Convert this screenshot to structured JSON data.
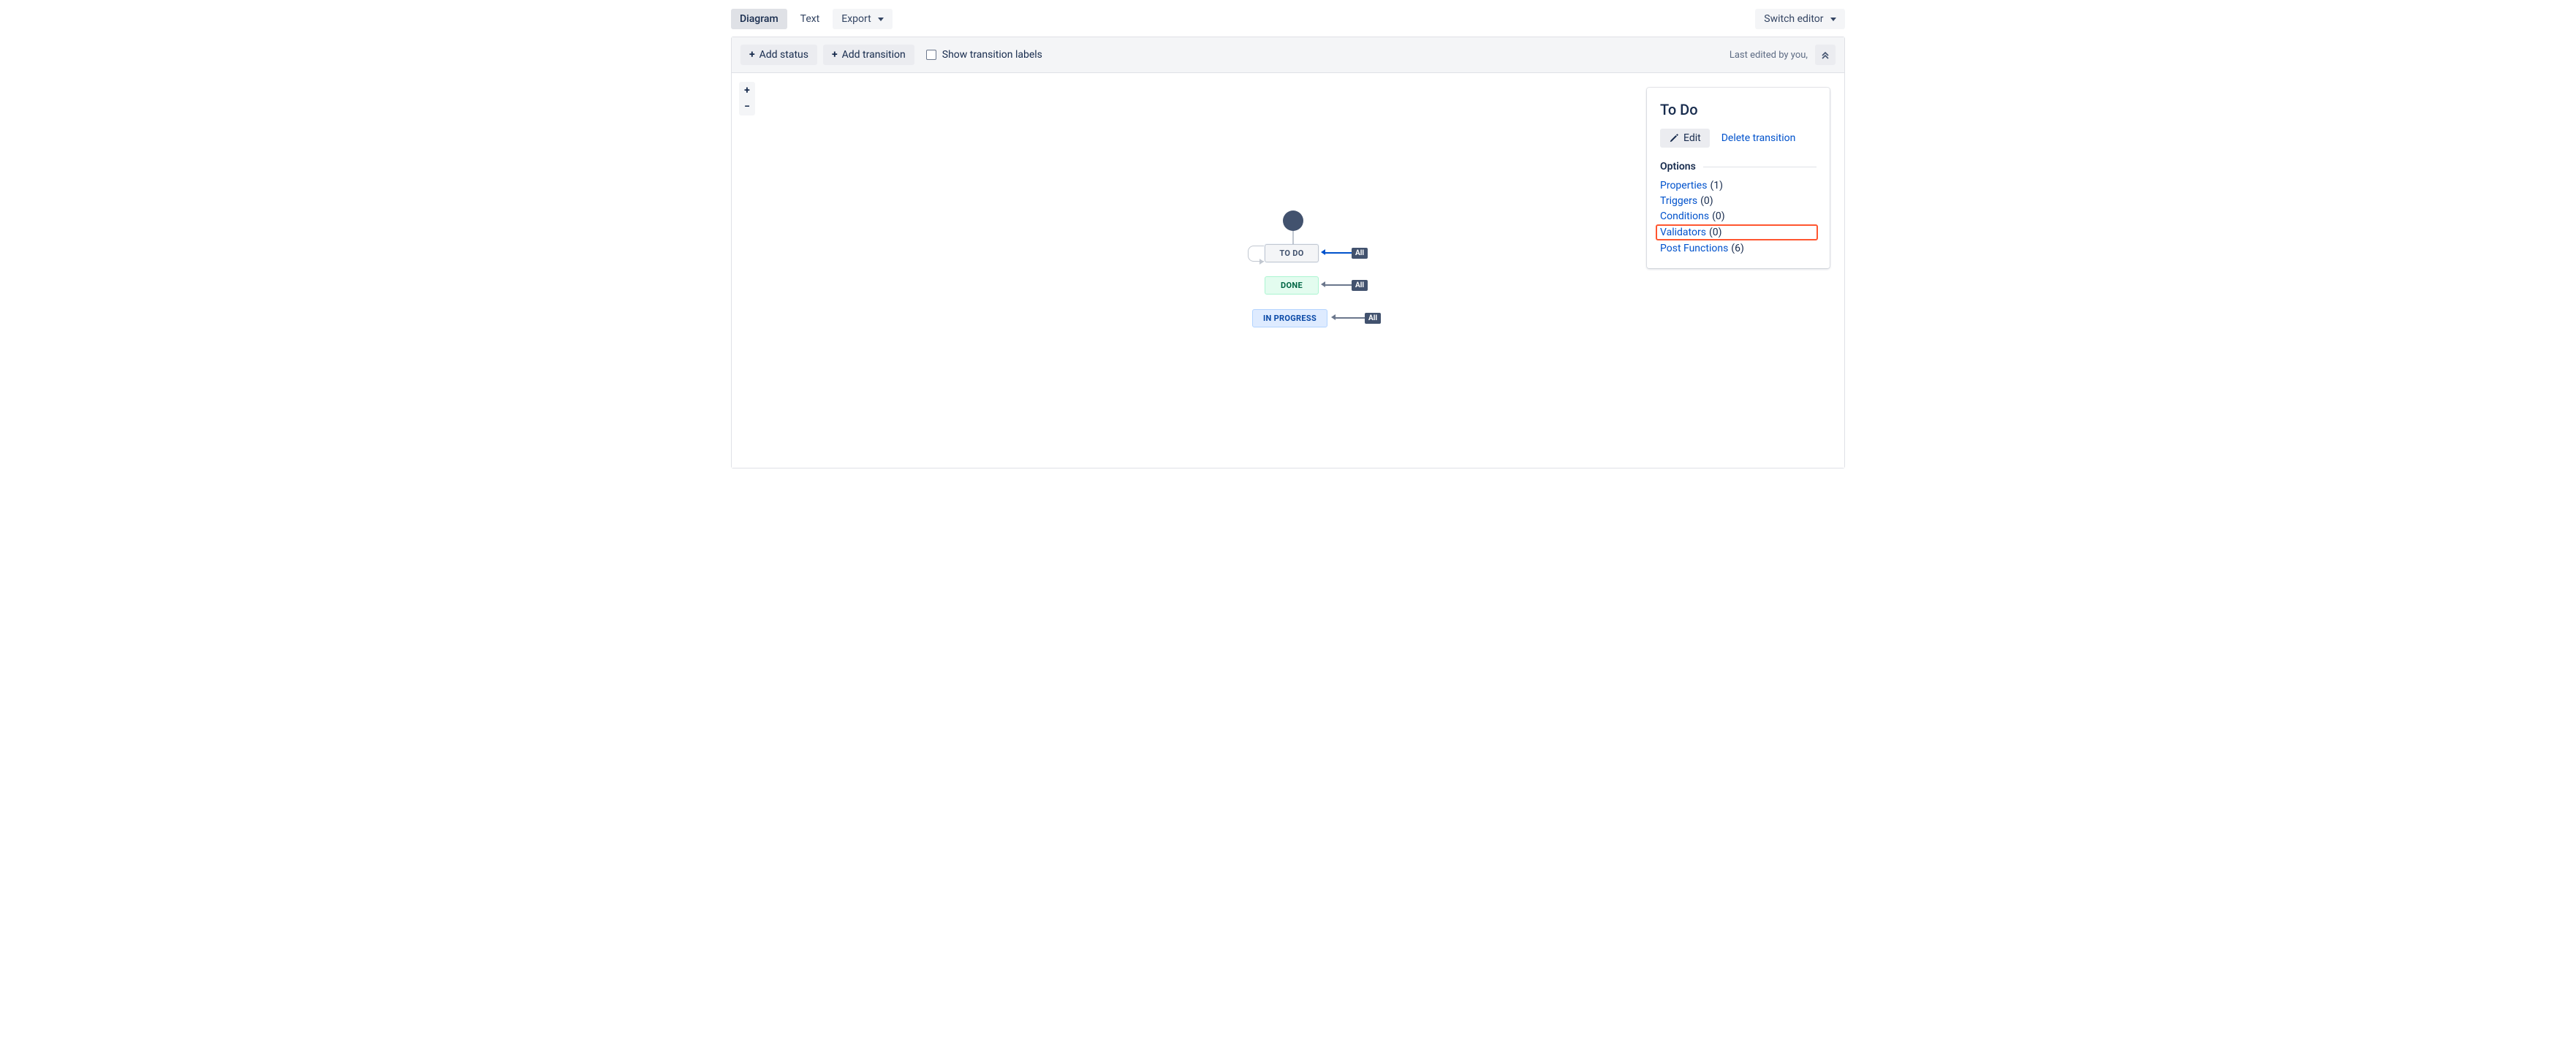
{
  "tabs": {
    "diagram": "Diagram",
    "text": "Text",
    "export": "Export",
    "switch": "Switch editor"
  },
  "toolbar": {
    "add_status": "Add status",
    "add_transition": "Add transition",
    "show_labels": "Show transition labels",
    "last_edited": "Last edited by you,"
  },
  "zoom": {
    "in": "+",
    "out": "−"
  },
  "nodes": {
    "todo": "TO DO",
    "done": "DONE",
    "inprogress": "IN PROGRESS",
    "all": "All"
  },
  "sidepanel": {
    "title": "To Do",
    "edit": "Edit",
    "delete": "Delete transition",
    "options_label": "Options",
    "options": {
      "properties": {
        "label": "Properties",
        "count": "(1)"
      },
      "triggers": {
        "label": "Triggers",
        "count": "(0)"
      },
      "conditions": {
        "label": "Conditions",
        "count": "(0)"
      },
      "validators": {
        "label": "Validators",
        "count": "(0)"
      },
      "postfns": {
        "label": "Post Functions",
        "count": "(6)"
      }
    }
  }
}
